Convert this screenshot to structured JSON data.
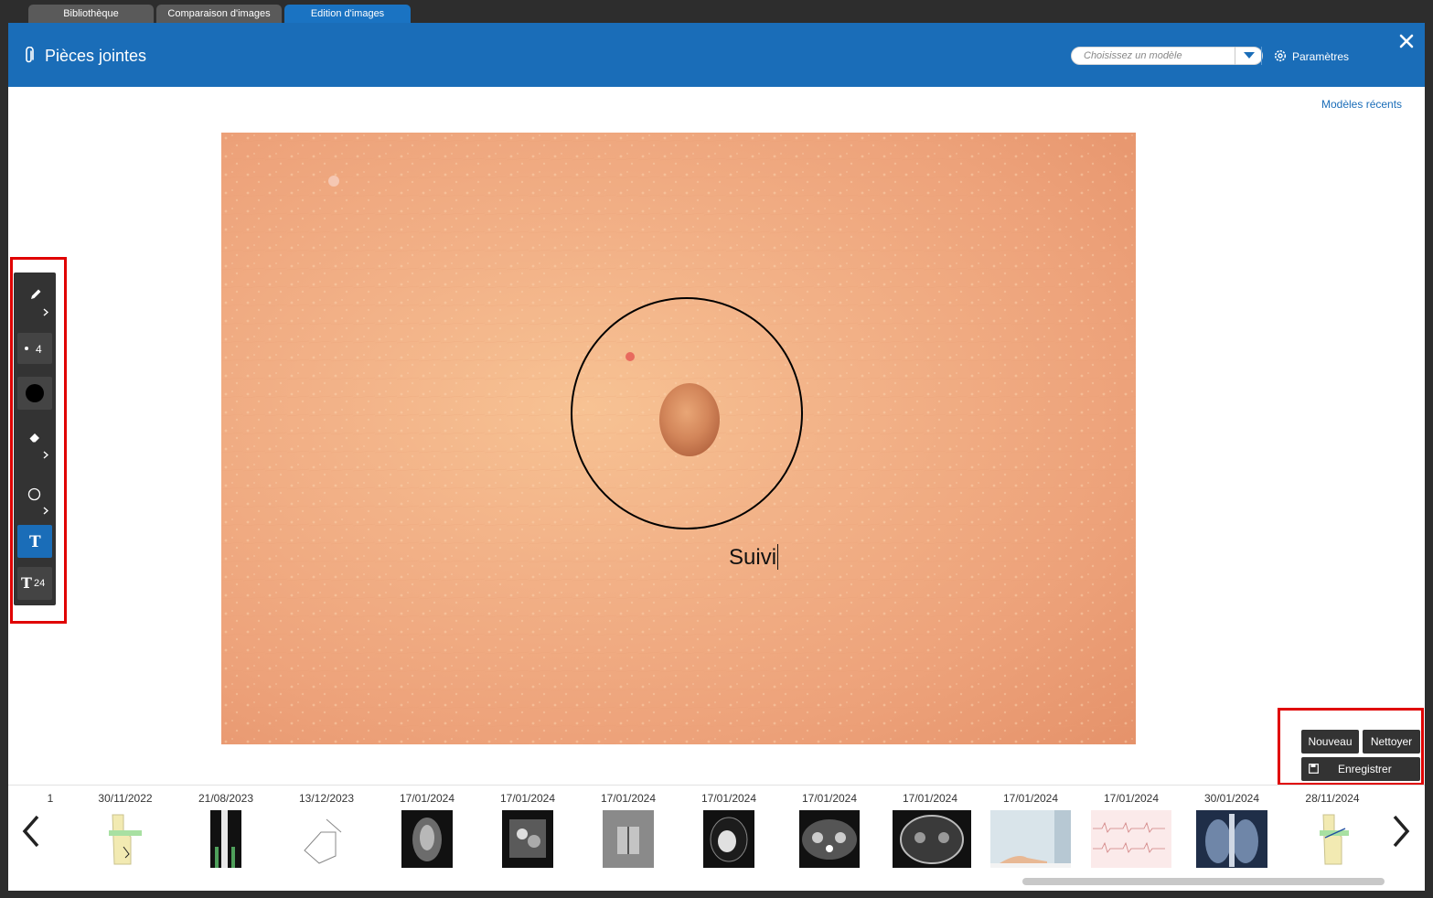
{
  "tabs": [
    {
      "label": "Bibliothèque"
    },
    {
      "label": "Comparaison d'images"
    },
    {
      "label": "Edition d'images"
    }
  ],
  "header": {
    "title": "Pièces jointes",
    "model_placeholder": "Choisissez un modèle",
    "settings_label": "Paramètres"
  },
  "recent_models_label": "Modèles récents",
  "toolbar": {
    "brush_size": "4",
    "text_size": "24",
    "text_tool_glyph": "T",
    "text_size_glyph": "T"
  },
  "annotation": {
    "text": "Suivi"
  },
  "actions": {
    "new_label": "Nouveau",
    "clean_label": "Nettoyer",
    "save_label": "Enregistrer"
  },
  "thumbnails": [
    {
      "date": "1",
      "kind": "knee"
    },
    {
      "date": "30/11/2022",
      "kind": "knee"
    },
    {
      "date": "21/08/2023",
      "kind": "xray-leg"
    },
    {
      "date": "13/12/2023",
      "kind": "sketch"
    },
    {
      "date": "17/01/2024",
      "kind": "xray-abdomen"
    },
    {
      "date": "17/01/2024",
      "kind": "mri"
    },
    {
      "date": "17/01/2024",
      "kind": "ct-head"
    },
    {
      "date": "17/01/2024",
      "kind": "ct-heart"
    },
    {
      "date": "17/01/2024",
      "kind": "ct-abdomen"
    },
    {
      "date": "17/01/2024",
      "kind": "ct-skull"
    },
    {
      "date": "17/01/2024",
      "kind": "photo-foot"
    },
    {
      "date": "17/01/2024",
      "kind": "ecg"
    },
    {
      "date": "30/01/2024",
      "kind": "xray-chest"
    },
    {
      "date": "28/11/2024",
      "kind": "knee"
    }
  ]
}
